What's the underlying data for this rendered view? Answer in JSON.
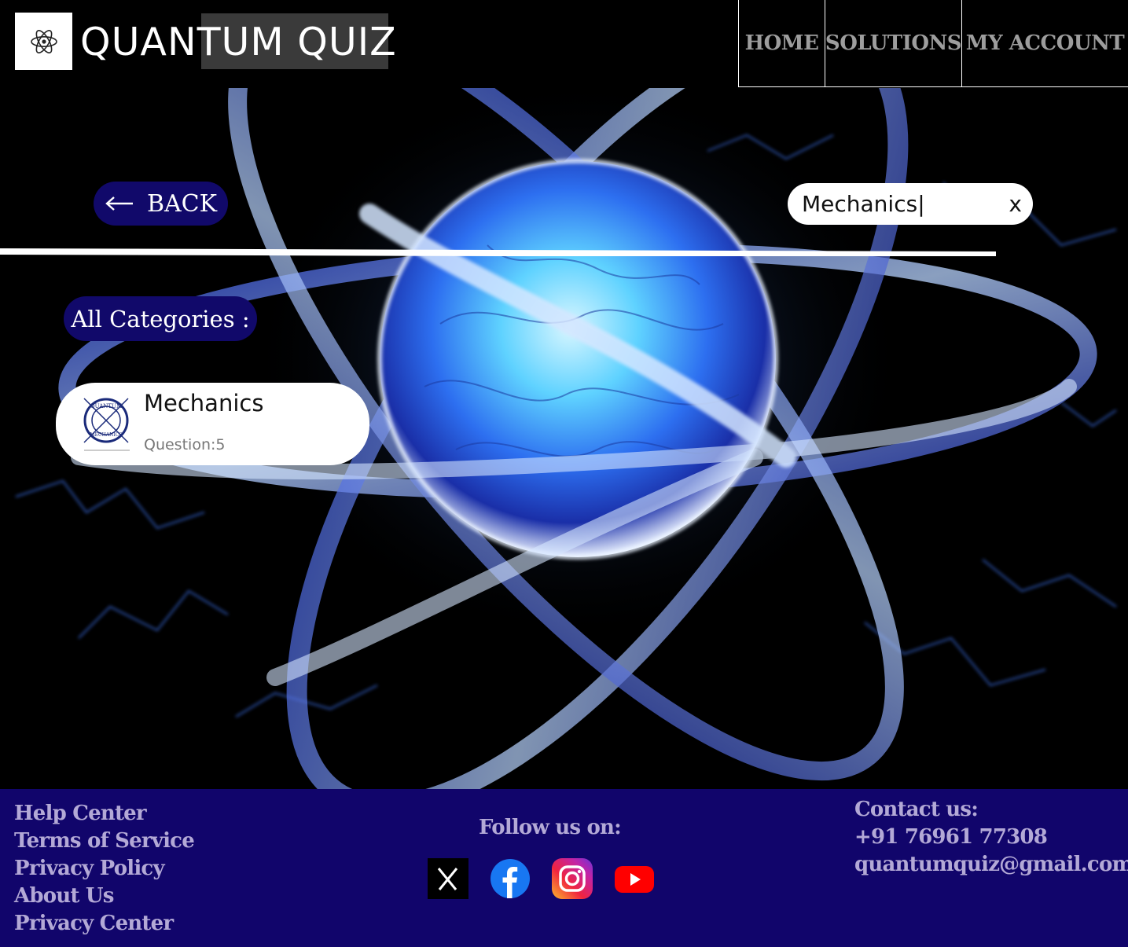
{
  "header": {
    "brand": "QUANTUM QUIZ",
    "logo_icon": "atom-icon",
    "nav": [
      {
        "label": "HOME"
      },
      {
        "label": "SOLUTIONS"
      },
      {
        "label": "MY ACCOUNT"
      }
    ]
  },
  "toolbar": {
    "back_label": "BACK",
    "back_icon": "arrow-left-icon",
    "search_value": "Mechanics|",
    "clear_label": "x"
  },
  "categories": {
    "heading": "All Categories :",
    "items": [
      {
        "name": "Mechanics",
        "questions_label": "Question:5",
        "thumb_text_top": "QUANTUM",
        "thumb_text_bottom": "MECHANICS"
      }
    ]
  },
  "footer": {
    "links": [
      "Help Center",
      "Terms of Service",
      "Privacy Policy",
      "About Us",
      "Privacy Center"
    ],
    "follow_label": "Follow us on:",
    "socials": [
      {
        "name": "x-icon"
      },
      {
        "name": "facebook-icon"
      },
      {
        "name": "instagram-icon"
      },
      {
        "name": "youtube-icon"
      }
    ],
    "contact_heading": "Contact us:",
    "phone": "+91 76961 77308",
    "email": "quantumquiz@gmail.com"
  },
  "colors": {
    "accent": "#11096a",
    "footer_bg": "#11056b",
    "footer_text": "#b3a9d6",
    "nav_text": "#9d9d9d"
  }
}
